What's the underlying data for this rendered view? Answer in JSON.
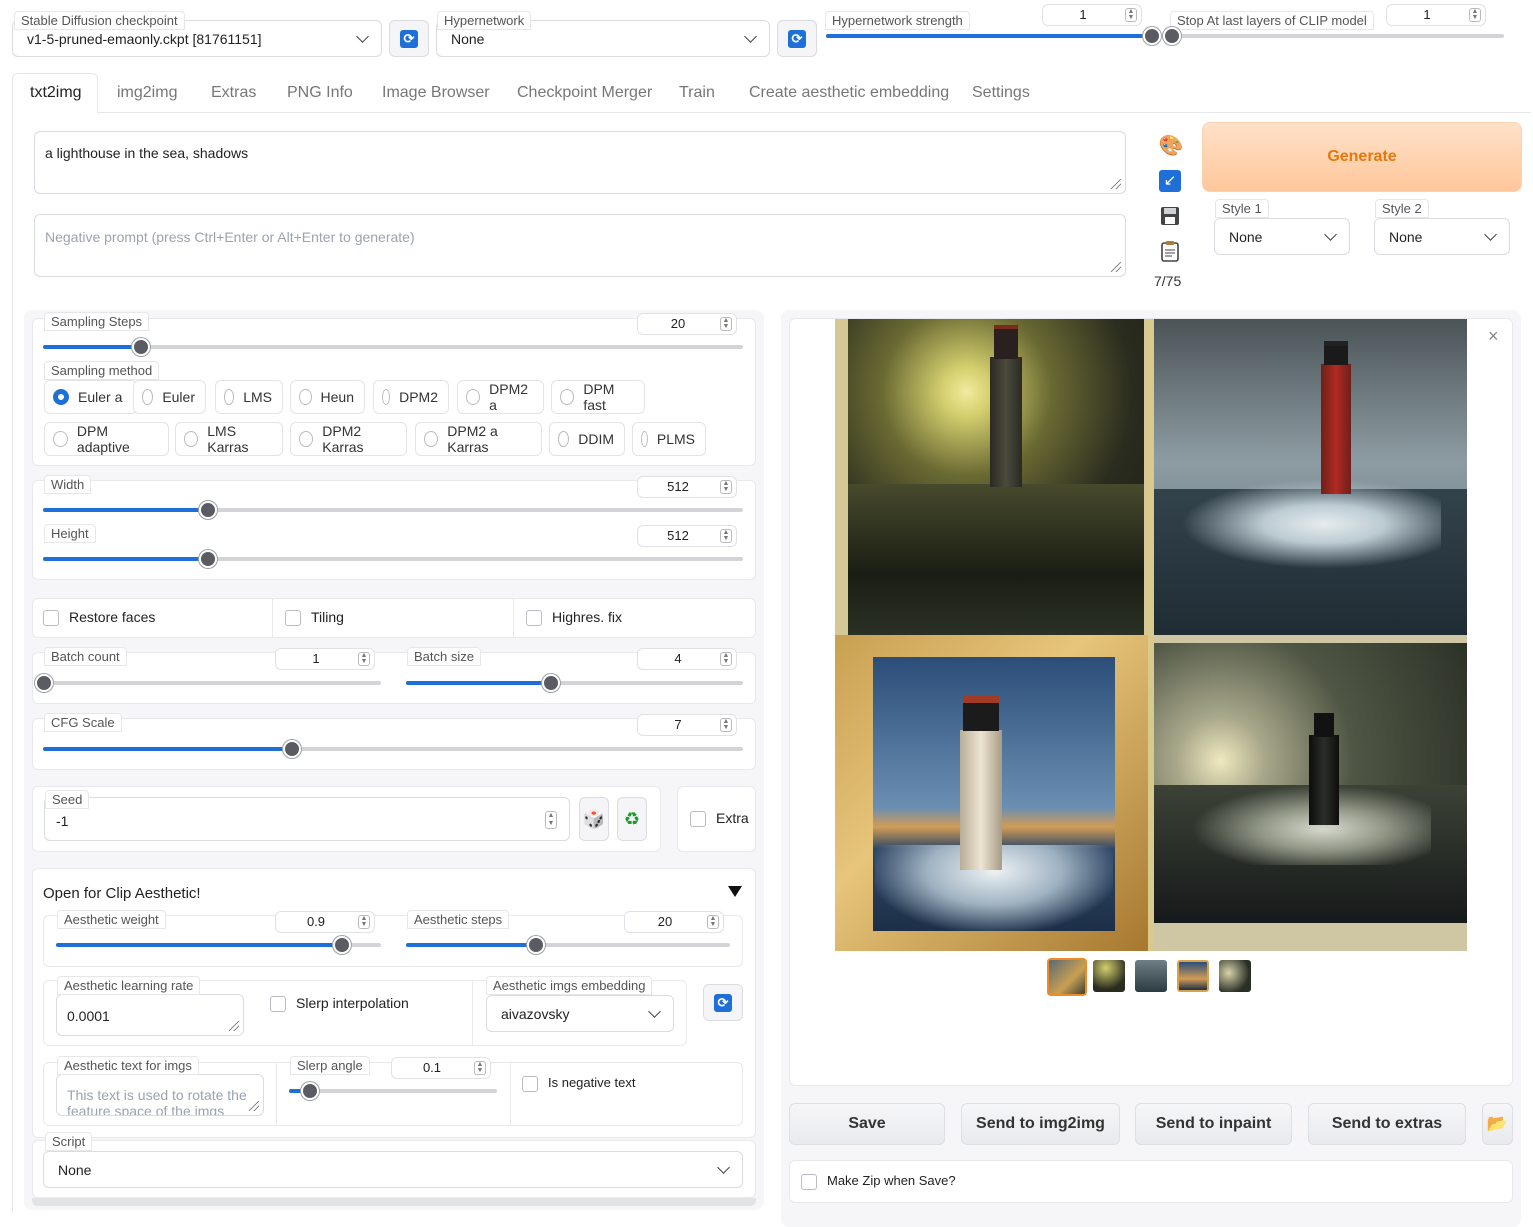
{
  "top": {
    "checkpoint_label": "Stable Diffusion checkpoint",
    "checkpoint_value": "v1-5-pruned-emaonly.ckpt [81761151]",
    "hypernetwork_label": "Hypernetwork",
    "hypernetwork_value": "None",
    "hn_strength_label": "Hypernetwork strength",
    "hn_strength_value": "1",
    "hn_strength_fraction": 1.0,
    "clip_label": "Stop At last layers of CLIP model",
    "clip_value": "1",
    "clip_fraction": 0.0
  },
  "tabs": [
    "txt2img",
    "img2img",
    "Extras",
    "PNG Info",
    "Image Browser",
    "Checkpoint Merger",
    "Train",
    "Create aesthetic embedding",
    "Settings"
  ],
  "active_tab": "txt2img",
  "prompt": {
    "value": "a lighthouse in the sea, shadows",
    "negative_placeholder": "Negative prompt (press Ctrl+Enter or Alt+Enter to generate)",
    "token_count": "7/75"
  },
  "generate_label": "Generate",
  "styles": {
    "style1_label": "Style 1",
    "style1_value": "None",
    "style2_label": "Style 2",
    "style2_value": "None"
  },
  "sampling": {
    "steps_label": "Sampling Steps",
    "steps_value": "20",
    "steps_fraction": 0.14,
    "method_label": "Sampling method",
    "methods": [
      "Euler a",
      "Euler",
      "LMS",
      "Heun",
      "DPM2",
      "DPM2 a",
      "DPM fast",
      "DPM adaptive",
      "LMS Karras",
      "DPM2 Karras",
      "DPM2 a Karras",
      "DDIM",
      "PLMS"
    ],
    "selected_method": "Euler a"
  },
  "size": {
    "width_label": "Width",
    "width_value": "512",
    "width_fraction": 0.235,
    "height_label": "Height",
    "height_value": "512",
    "height_fraction": 0.235
  },
  "options": {
    "restore_faces": "Restore faces",
    "tiling": "Tiling",
    "highres": "Highres. fix"
  },
  "batch": {
    "count_label": "Batch count",
    "count_value": "1",
    "count_fraction": 0.0,
    "size_label": "Batch size",
    "size_value": "4",
    "size_fraction": 0.43
  },
  "cfg": {
    "label": "CFG Scale",
    "value": "7",
    "fraction": 0.355
  },
  "seed": {
    "label": "Seed",
    "value": "-1",
    "extra_label": "Extra"
  },
  "aesthetic": {
    "header": "Open for Clip Aesthetic!",
    "weight_label": "Aesthetic weight",
    "weight_value": "0.9",
    "weight_fraction": 0.88,
    "steps_label": "Aesthetic steps",
    "steps_value": "20",
    "steps_fraction": 0.4,
    "lr_label": "Aesthetic learning rate",
    "lr_value": "0.0001",
    "slerp_label": "Slerp interpolation",
    "embedding_label": "Aesthetic imgs embedding",
    "embedding_value": "aivazovsky",
    "text_label": "Aesthetic text for imgs",
    "text_placeholder": "This text is used to rotate the feature space of the imgs embs",
    "slerp_angle_label": "Slerp angle",
    "slerp_angle_value": "0.1",
    "slerp_angle_fraction": 0.1,
    "negative_text_label": "Is negative text"
  },
  "script": {
    "label": "Script",
    "value": "None"
  },
  "output": {
    "save": "Save",
    "send_img2img": "Send to img2img",
    "send_inpaint": "Send to inpaint",
    "send_extras": "Send to extras",
    "zip_label": "Make Zip when Save?"
  }
}
